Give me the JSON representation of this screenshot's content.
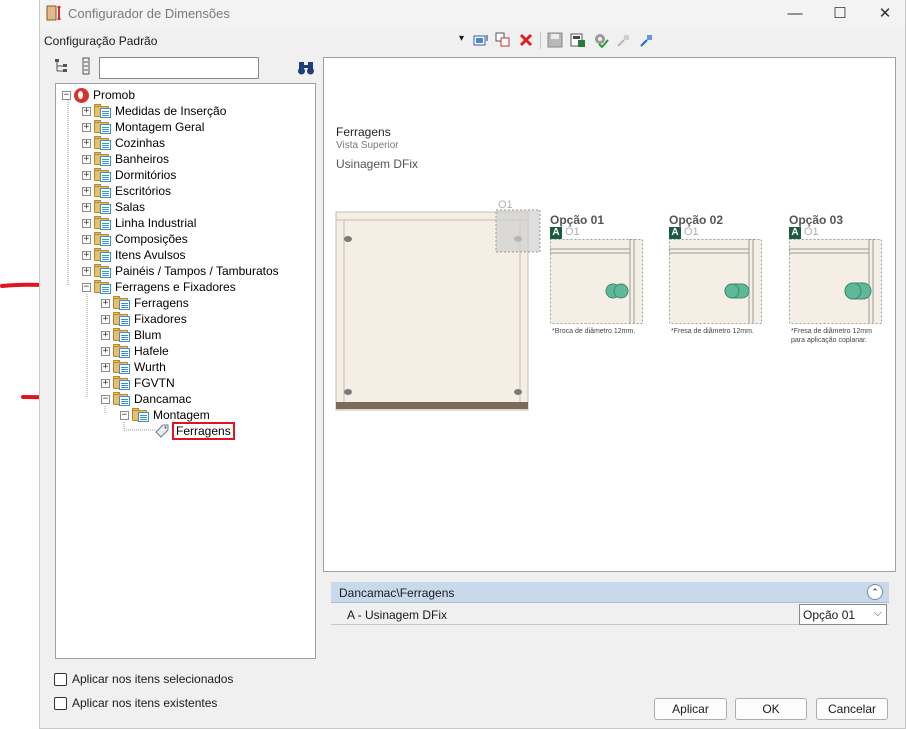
{
  "window": {
    "title": "Configurador de Dimensões",
    "minimize": "—",
    "maximize": "☐",
    "close": "✕"
  },
  "toolbar": {
    "config_label": "Configuração Padrão",
    "dropdown_arrow": "▾"
  },
  "search": {
    "value": "",
    "placeholder": ""
  },
  "tree": {
    "root": "Promob",
    "items": [
      "Medidas de Inserção",
      "Montagem Geral",
      "Cozinhas",
      "Banheiros",
      "Dormitórios",
      "Escritórios",
      "Salas",
      "Linha Industrial",
      "Composições",
      "Itens Avulsos",
      "Painéis / Tampos / Tamburatos",
      "Ferragens e Fixadores"
    ],
    "ferragens_children": [
      "Ferragens",
      "Fixadores",
      "Blum",
      "Hafele",
      "Wurth",
      "FGVTN",
      "Dancamac"
    ],
    "dancamac_child": "Montagem",
    "montagem_child": "Ferragens"
  },
  "preview": {
    "title": "Ferragens",
    "subtitle": "Vista Superior",
    "section": "Usinagem DFix",
    "marker_label": "O1",
    "options": [
      {
        "title": "Opção 01",
        "badge": "A",
        "code": "O1",
        "note_line1": "*Broca de diâmetro 12mm.",
        "note_line2": ""
      },
      {
        "title": "Opção 02",
        "badge": "A",
        "code": "O1",
        "note_line1": "*Fresa de diâmetro 12mm.",
        "note_line2": ""
      },
      {
        "title": "Opção 03",
        "badge": "A",
        "code": "O1",
        "note_line1": "*Fresa de diâmetro 12mm",
        "note_line2": "para aplicação coplanar."
      }
    ]
  },
  "properties": {
    "group_label": "Dancamac\\Ferragens",
    "collapse_glyph": "⌃",
    "row_label": "A - Usinagem DFix",
    "row_value": "Opção 01",
    "chevron": "⌵"
  },
  "checkboxes": {
    "selected_items": "Aplicar nos itens selecionados",
    "existing_items": "Aplicar nos itens existentes"
  },
  "buttons": {
    "apply": "Aplicar",
    "ok": "OK",
    "cancel": "Cancelar"
  },
  "colors": {
    "arrow": "#e0141e",
    "badge": "#1a5c42",
    "group_bar": "#c9d9ec",
    "hardware": "#5fb89a"
  }
}
